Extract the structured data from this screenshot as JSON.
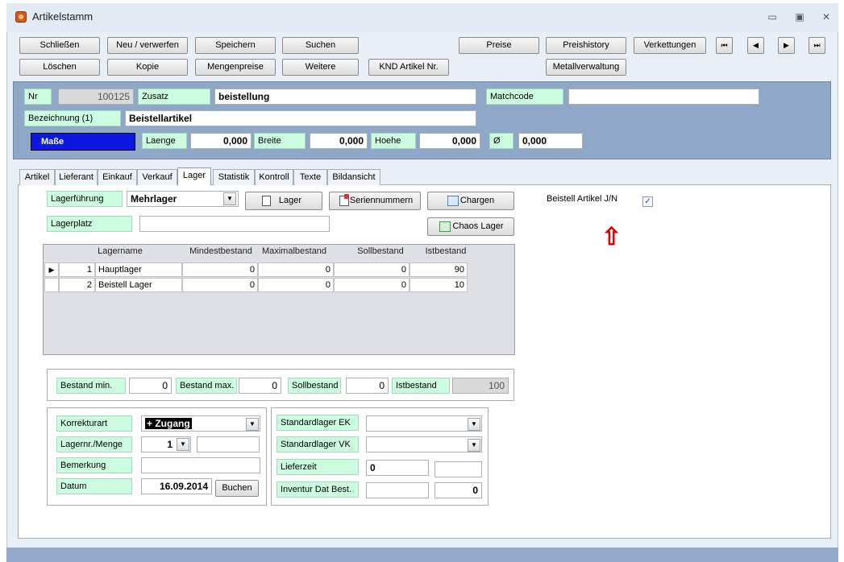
{
  "window": {
    "title": "Artikelstamm",
    "controls": [
      "▭",
      "▣",
      "✕"
    ]
  },
  "toolbar": {
    "row1": [
      "Schließen",
      "Neu / verwerfen",
      "Speichern",
      "Suchen",
      "Preise",
      "Preishistory",
      "Verkettungen"
    ],
    "row2": [
      "Löschen",
      "Kopie",
      "Mengenpreise",
      "Weitere",
      "KND Artikel Nr.",
      "Metallverwaltung"
    ],
    "nav": [
      "⏮",
      "◀",
      "▶",
      "⏭"
    ]
  },
  "header": {
    "nr_label": "Nr",
    "nr_value": "100125",
    "zusatz_label": "Zusatz",
    "zusatz_value": "beistellung",
    "matchcode_label": "Matchcode",
    "matchcode_value": "",
    "bezeichnung_label": "Bezeichnung (1)",
    "bezeichnung_value": "Beistellartikel",
    "masse_label": "Maße",
    "laenge_label": "Laenge",
    "laenge_value": "0,000",
    "breite_label": "Breite",
    "breite_value": "0,000",
    "hoehe_label": "Hoehe",
    "hoehe_value": "0,000",
    "dia_label": "Ø",
    "dia_value": "0,000"
  },
  "tabs": [
    "Artikel",
    "Lieferant",
    "Einkauf",
    "Verkauf",
    "Lager",
    "Statistik",
    "Kontroll",
    "Texte",
    "Bildansicht"
  ],
  "active_tab": "Lager",
  "lager": {
    "fuehrung_label": "Lagerführung",
    "fuehrung_value": "Mehrlager",
    "lagerplatz_label": "Lagerplatz",
    "lagerplatz_value": "",
    "btn_lager": "Lager",
    "btn_serien": "Seriennummern",
    "btn_chargen": "Chargen",
    "btn_chaos": "Chaos Lager",
    "beistell_label": "Beistell Artikel J/N",
    "beistell_checked": "✓",
    "arrow": "⇧"
  },
  "grid": {
    "headers": [
      "Lagername",
      "Mindestbestand",
      "Maximalbestand",
      "Sollbestand",
      "Istbestand"
    ],
    "rows": [
      {
        "nr": "1",
        "name": "Hauptlager",
        "min": "0",
        "max": "0",
        "soll": "0",
        "ist": "90"
      },
      {
        "nr": "2",
        "name": "Beistell Lager",
        "min": "0",
        "max": "0",
        "soll": "0",
        "ist": "10"
      }
    ],
    "row_indicator": "▶"
  },
  "bestand": {
    "min_label": "Bestand min.",
    "min_value": "0",
    "max_label": "Bestand max.",
    "max_value": "0",
    "soll_label": "Sollbestand",
    "soll_value": "0",
    "ist_label": "Istbestand",
    "ist_value": "100"
  },
  "korrektur": {
    "art_label": "Korrekturart",
    "art_value": "+ Zugang",
    "menge_label": "Lagernr./Menge",
    "menge_value": "1",
    "menge_extra": "",
    "bemerkung_label": "Bemerkung",
    "bemerkung_value": "",
    "datum_label": "Datum",
    "datum_value": "16.09.2014",
    "buchen": "Buchen"
  },
  "standard": {
    "ek_label": "Standardlager EK",
    "ek_value": "",
    "vk_label": "Standardlager VK",
    "vk_value": "",
    "lieferzeit_label": "Lieferzeit",
    "lieferzeit_value": "0",
    "lieferzeit_extra": "",
    "inventur_label": "Inventur Dat Best.",
    "inventur_date": "",
    "inventur_value": "0"
  },
  "icons": {
    "dropdown": "▼"
  },
  "colors": {
    "label_bg": "#ccfde0",
    "header_bg": "#8fa8c8",
    "masse_bg": "#0a18e0",
    "arrow": "#e00000"
  }
}
